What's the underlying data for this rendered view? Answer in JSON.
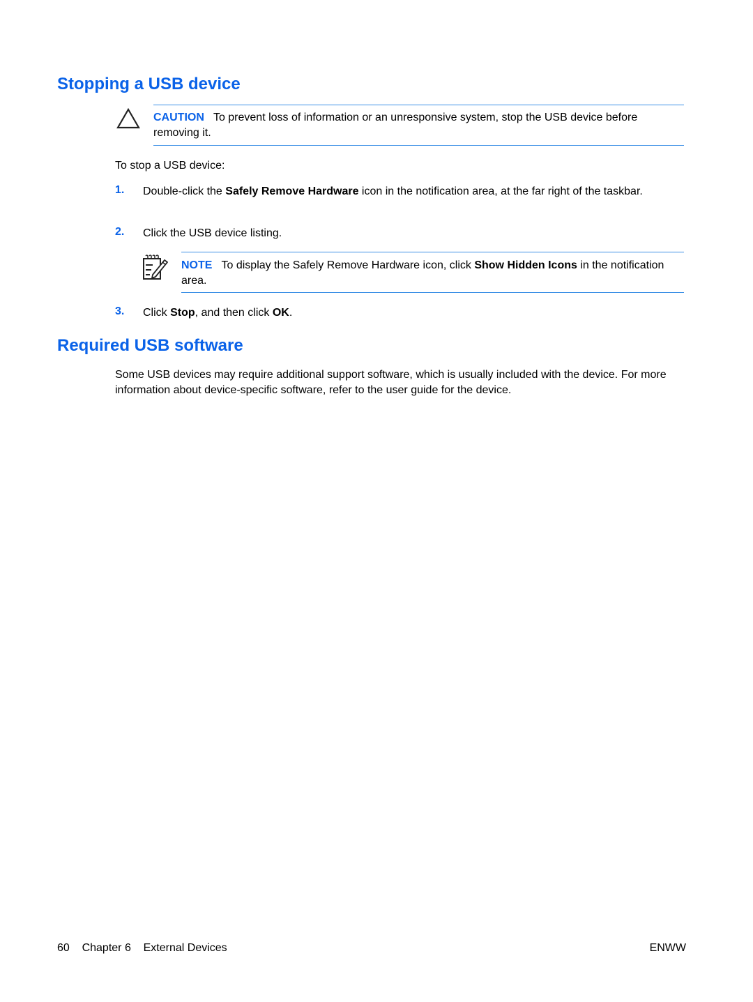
{
  "section1": {
    "title": "Stopping a USB device",
    "caution": {
      "icon": "caution-triangle-icon",
      "label": "CAUTION",
      "text": "To prevent loss of information or an unresponsive system, stop the USB device before removing it."
    },
    "intro": "To stop a USB device:",
    "steps": [
      {
        "number": "1.",
        "pre": "Double-click the ",
        "bold": "Safely Remove Hardware",
        "post": " icon in the notification area, at the far right of the taskbar."
      },
      {
        "number": "2.",
        "text": "Click the USB device listing."
      },
      {
        "number": "3.",
        "pre": "Click ",
        "bold1": "Stop",
        "mid": ", and then click ",
        "bold2": "OK",
        "post": "."
      }
    ],
    "note": {
      "icon": "note-pencil-icon",
      "label": "NOTE",
      "pre": "To display the Safely Remove Hardware icon, click ",
      "bold": "Show Hidden Icons",
      "post": " in the notification area."
    }
  },
  "section2": {
    "title": "Required USB software",
    "paragraph": "Some USB devices may require additional support software, which is usually included with the device. For more information about device-specific software, refer to the user guide for the device."
  },
  "footer": {
    "page_number": "60",
    "chapter": "Chapter 6",
    "chapter_title": "External Devices",
    "locale": "ENWW"
  },
  "colors": {
    "heading": "#0a62e8",
    "rule": "#3b8fe6"
  }
}
